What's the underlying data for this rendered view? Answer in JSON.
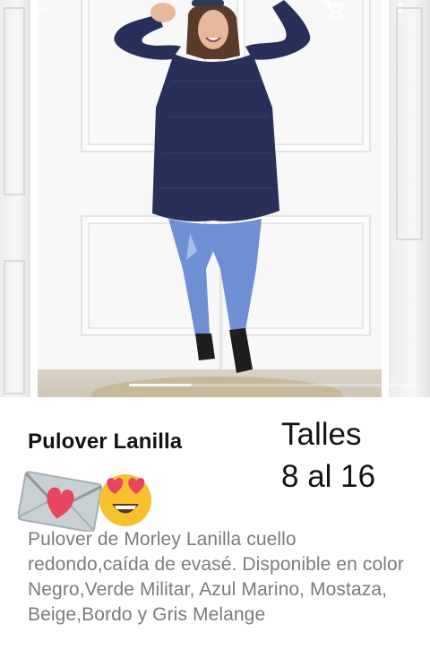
{
  "product": {
    "title": "Pulover Lanilla",
    "sizes_heading": "Talles",
    "sizes_range": "8 al 16",
    "emojis": [
      "love-letter-emoji",
      "heart-eyes-emoji"
    ],
    "description": "Pulover de Morley Lanilla cuello redondo,caída de evasé. Disponible en color Negro,Verde Militar, Azul Marino, Mostaza, Beige,Bordo y Gris Melange"
  },
  "toolbar": {
    "icons": [
      "back-arrow-icon",
      "cart-icon",
      "more-vert-icon"
    ]
  },
  "carousel": {
    "photo_description": "model-wearing-navy-pullover",
    "active_index": 1
  },
  "colors": {
    "sweater": "#28305a",
    "jeans": "#6e8fd3",
    "title_text": "#141414",
    "description_text": "#7b7b7b"
  }
}
